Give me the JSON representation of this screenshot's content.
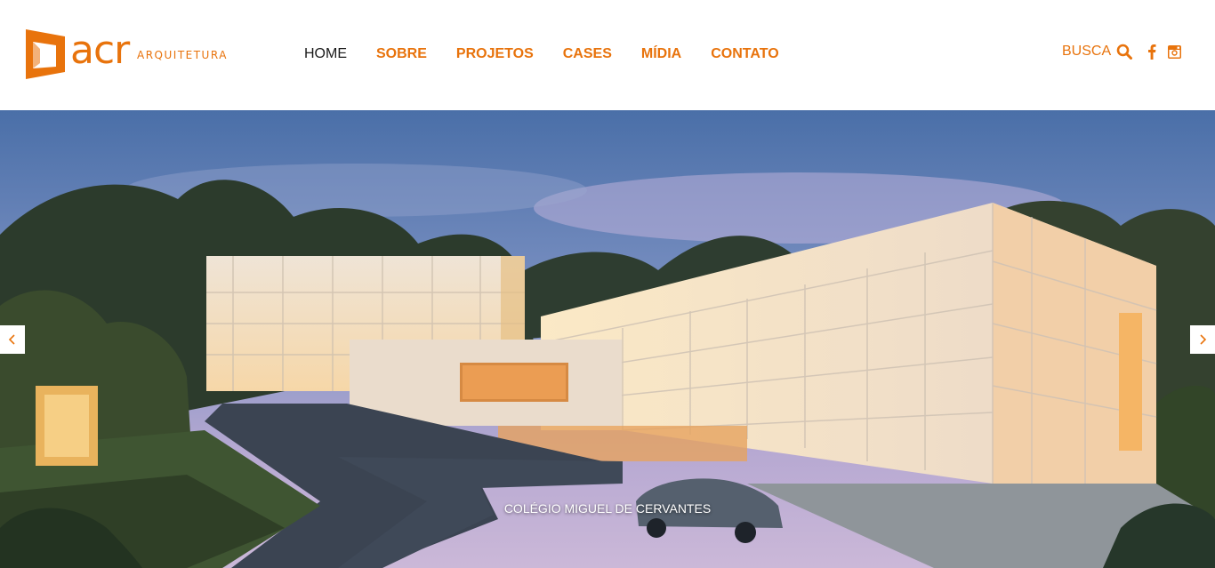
{
  "brand": {
    "name": "acr",
    "subtitle": "ARQUITETURA",
    "accent_color": "#e8730c"
  },
  "nav": {
    "items": [
      {
        "label": "HOME",
        "active": true
      },
      {
        "label": "SOBRE",
        "active": false
      },
      {
        "label": "PROJETOS",
        "active": false
      },
      {
        "label": "CASES",
        "active": false
      },
      {
        "label": "MÍDIA",
        "active": false
      },
      {
        "label": "CONTATO",
        "active": false
      }
    ]
  },
  "tools": {
    "search_label": "BUSCA",
    "search_icon": "search-icon",
    "social": [
      "facebook-icon",
      "instagram-icon"
    ]
  },
  "hero": {
    "caption": "COLÉGIO MIGUEL DE CERVANTES",
    "prev_icon": "chevron-left-icon",
    "next_icon": "chevron-right-icon"
  }
}
